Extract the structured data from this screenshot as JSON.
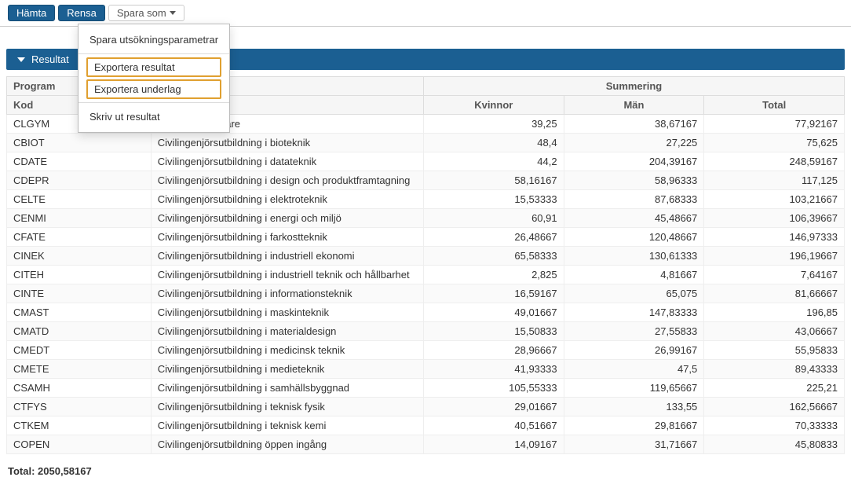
{
  "toolbar": {
    "fetch": "Hämta",
    "clear": "Rensa",
    "saveas": "Spara som"
  },
  "dropdown": {
    "saveParams": "Spara utsökningsparametrar",
    "exportResult": "Exportera resultat",
    "exportBasis": "Exportera underlag",
    "printResult": "Skriv ut resultat"
  },
  "section": {
    "title": "Resultat"
  },
  "headers": {
    "program": "Program",
    "kod": "Kod",
    "summering": "Summering",
    "kvinnor": "Kvinnor",
    "man": "Män",
    "total": "Total",
    "visibleNameFrag": "lärare"
  },
  "rows": [
    {
      "kod": "CLGYM",
      "kvinnor": "39,25",
      "man": "38,67167",
      "total": "77,92167"
    },
    {
      "kod": "CBIOT",
      "name": "Civilingenjörsutbildning i bioteknik",
      "kvinnor": "48,4",
      "man": "27,225",
      "total": "75,625"
    },
    {
      "kod": "CDATE",
      "name": "Civilingenjörsutbildning i datateknik",
      "kvinnor": "44,2",
      "man": "204,39167",
      "total": "248,59167"
    },
    {
      "kod": "CDEPR",
      "name": "Civilingenjörsutbildning i design och produktframtagning",
      "kvinnor": "58,16167",
      "man": "58,96333",
      "total": "117,125"
    },
    {
      "kod": "CELTE",
      "name": "Civilingenjörsutbildning i elektroteknik",
      "kvinnor": "15,53333",
      "man": "87,68333",
      "total": "103,21667"
    },
    {
      "kod": "CENMI",
      "name": "Civilingenjörsutbildning i energi och miljö",
      "kvinnor": "60,91",
      "man": "45,48667",
      "total": "106,39667"
    },
    {
      "kod": "CFATE",
      "name": "Civilingenjörsutbildning i farkostteknik",
      "kvinnor": "26,48667",
      "man": "120,48667",
      "total": "146,97333"
    },
    {
      "kod": "CINEK",
      "name": "Civilingenjörsutbildning i industriell ekonomi",
      "kvinnor": "65,58333",
      "man": "130,61333",
      "total": "196,19667"
    },
    {
      "kod": "CITEH",
      "name": "Civilingenjörsutbildning i industriell teknik och hållbarhet",
      "kvinnor": "2,825",
      "man": "4,81667",
      "total": "7,64167"
    },
    {
      "kod": "CINTE",
      "name": "Civilingenjörsutbildning i informationsteknik",
      "kvinnor": "16,59167",
      "man": "65,075",
      "total": "81,66667"
    },
    {
      "kod": "CMAST",
      "name": "Civilingenjörsutbildning i maskinteknik",
      "kvinnor": "49,01667",
      "man": "147,83333",
      "total": "196,85"
    },
    {
      "kod": "CMATD",
      "name": "Civilingenjörsutbildning i materialdesign",
      "kvinnor": "15,50833",
      "man": "27,55833",
      "total": "43,06667"
    },
    {
      "kod": "CMEDT",
      "name": "Civilingenjörsutbildning i medicinsk teknik",
      "kvinnor": "28,96667",
      "man": "26,99167",
      "total": "55,95833"
    },
    {
      "kod": "CMETE",
      "name": "Civilingenjörsutbildning i medieteknik",
      "kvinnor": "41,93333",
      "man": "47,5",
      "total": "89,43333"
    },
    {
      "kod": "CSAMH",
      "name": "Civilingenjörsutbildning i samhällsbyggnad",
      "kvinnor": "105,55333",
      "man": "119,65667",
      "total": "225,21"
    },
    {
      "kod": "CTFYS",
      "name": "Civilingenjörsutbildning i teknisk fysik",
      "kvinnor": "29,01667",
      "man": "133,55",
      "total": "162,56667"
    },
    {
      "kod": "CTKEM",
      "name": "Civilingenjörsutbildning i teknisk kemi",
      "kvinnor": "40,51667",
      "man": "29,81667",
      "total": "70,33333"
    },
    {
      "kod": "COPEN",
      "name": "Civilingenjörsutbildning öppen ingång",
      "kvinnor": "14,09167",
      "man": "31,71667",
      "total": "45,80833"
    }
  ],
  "footer": {
    "totalLabel": "Total:",
    "totalValue": "2050,58167"
  }
}
